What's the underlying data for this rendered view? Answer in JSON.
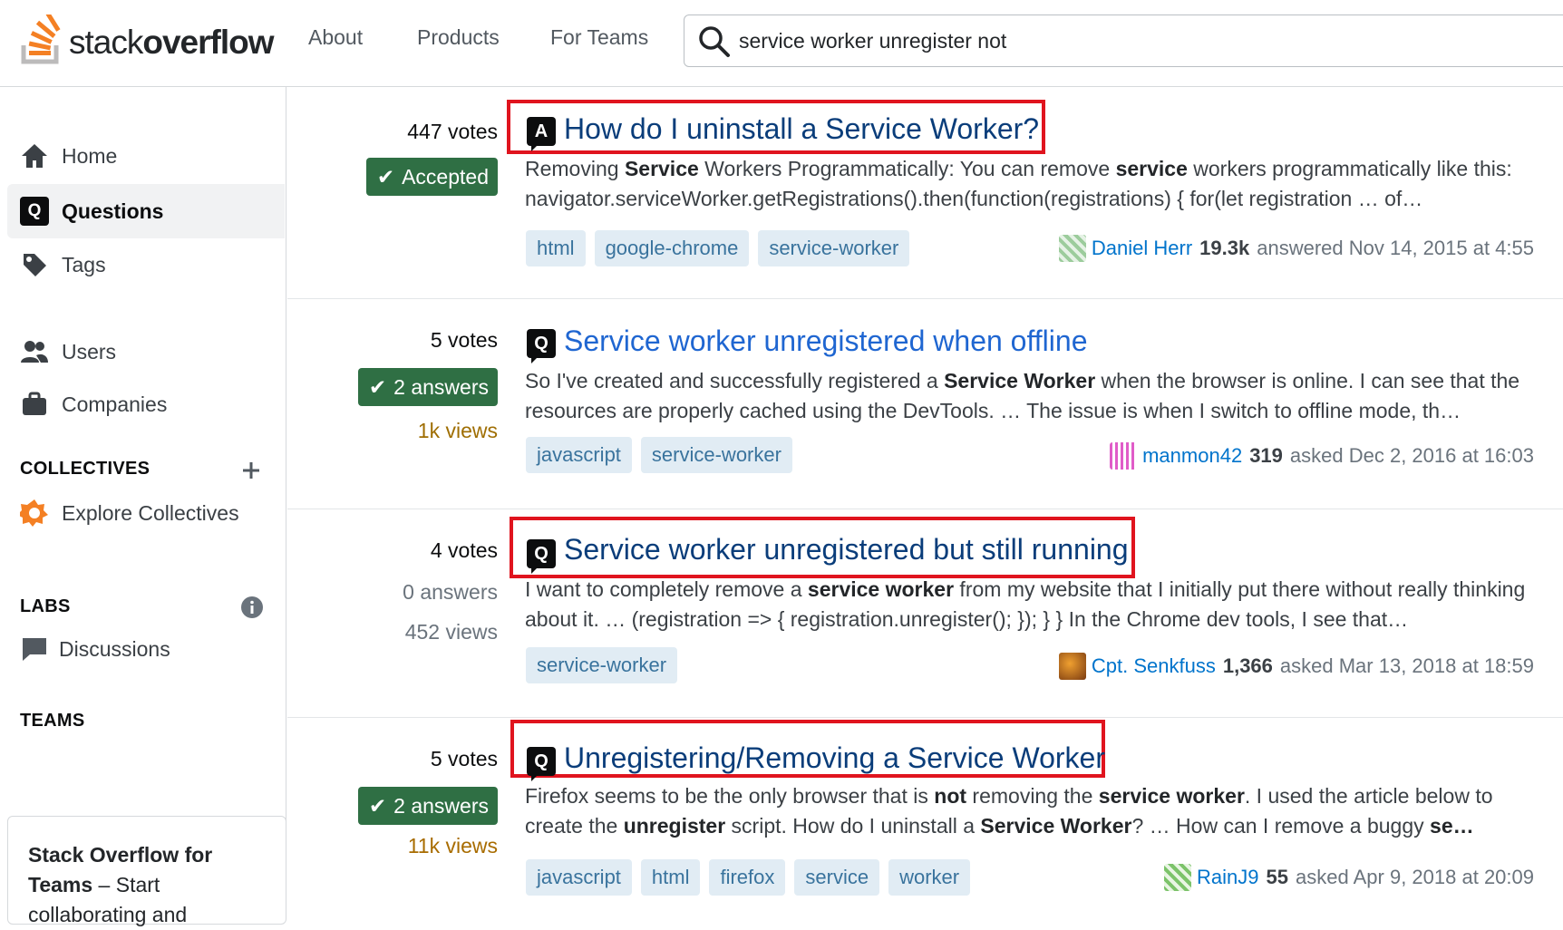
{
  "header": {
    "logo_text_light": "stack",
    "logo_text_bold": "overflow",
    "nav": [
      "About",
      "Products",
      "For Teams"
    ],
    "search_value": "service worker unregister not"
  },
  "sidebar": {
    "items": [
      {
        "label": "Home",
        "icon": "home-icon"
      },
      {
        "label": "Questions",
        "icon": "questions-icon",
        "active": true
      },
      {
        "label": "Tags",
        "icon": "tag-icon"
      },
      {
        "label": "Users",
        "icon": "users-icon"
      },
      {
        "label": "Companies",
        "icon": "briefcase-icon"
      }
    ],
    "collectives_heading": "COLLECTIVES",
    "explore_collectives": "Explore Collectives",
    "labs_heading": "LABS",
    "discussions": "Discussions",
    "teams_heading": "TEAMS",
    "teams_promo_bold": "Stack Overflow for Teams",
    "teams_promo_rest": " – Start collaborating and"
  },
  "results": [
    {
      "type": "A",
      "votes": "447 votes",
      "status": "Accepted",
      "title": "How do I uninstall a Service Worker?",
      "excerpt_html_parts": [
        "Removing ",
        "Service",
        " Workers Programmatically: You can remove ",
        "service",
        " workers programmatically like this: navigator.serviceWorker.getRegistrations().then(function(registrations) { for(let registration … of…"
      ],
      "tags": [
        "html",
        "google-chrome",
        "service-worker"
      ],
      "user": "Daniel Herr",
      "rep": "19.3k",
      "action": "answered Nov 14, 2015 at 4:55",
      "highlighted": true
    },
    {
      "type": "Q",
      "votes": "5 votes",
      "answers": "2 answers",
      "views": "1k views",
      "title": "Service worker unregistered when offline",
      "excerpt_html_parts": [
        "So I've created and successfully registered a ",
        "Service Worker",
        " when the browser is online. I can see that the resources are properly cached using the DevTools. … The issue is when I switch to offline mode, th…"
      ],
      "tags": [
        "javascript",
        "service-worker"
      ],
      "user": "manmon42",
      "rep": "319",
      "action": "asked Dec 2, 2016 at 16:03",
      "highlighted": false
    },
    {
      "type": "Q",
      "votes": "4 votes",
      "answers": "0 answers",
      "views": "452 views",
      "title": "Service worker unregistered but still running",
      "excerpt_html_parts": [
        "I want to completely remove a ",
        "service worker",
        " from my website that I initially put there without really thinking about it. … (registration => { registration.unregister(); }); } } In the Chrome dev tools, I see that…"
      ],
      "tags": [
        "service-worker"
      ],
      "user": "Cpt. Senkfuss",
      "rep": "1,366",
      "action": "asked Mar 13, 2018 at 18:59",
      "highlighted": true
    },
    {
      "type": "Q",
      "votes": "5 votes",
      "answers": "2 answers",
      "views": "11k views",
      "title": "Unregistering/Removing a Service Worker",
      "excerpt_html_parts": [
        "Firefox seems to be the only browser that is ",
        "not",
        " removing the ",
        "service worker",
        ". I used the article below to create the ",
        "unregister",
        " script. How do I uninstall a ",
        "Service Worker",
        "? … How can I remove a buggy ",
        "se…"
      ],
      "tags": [
        "javascript",
        "html",
        "firefox",
        "service",
        "worker"
      ],
      "user": "RainJ9",
      "rep": "55",
      "action": "asked Apr 9, 2018 at 20:09",
      "highlighted": true
    }
  ]
}
